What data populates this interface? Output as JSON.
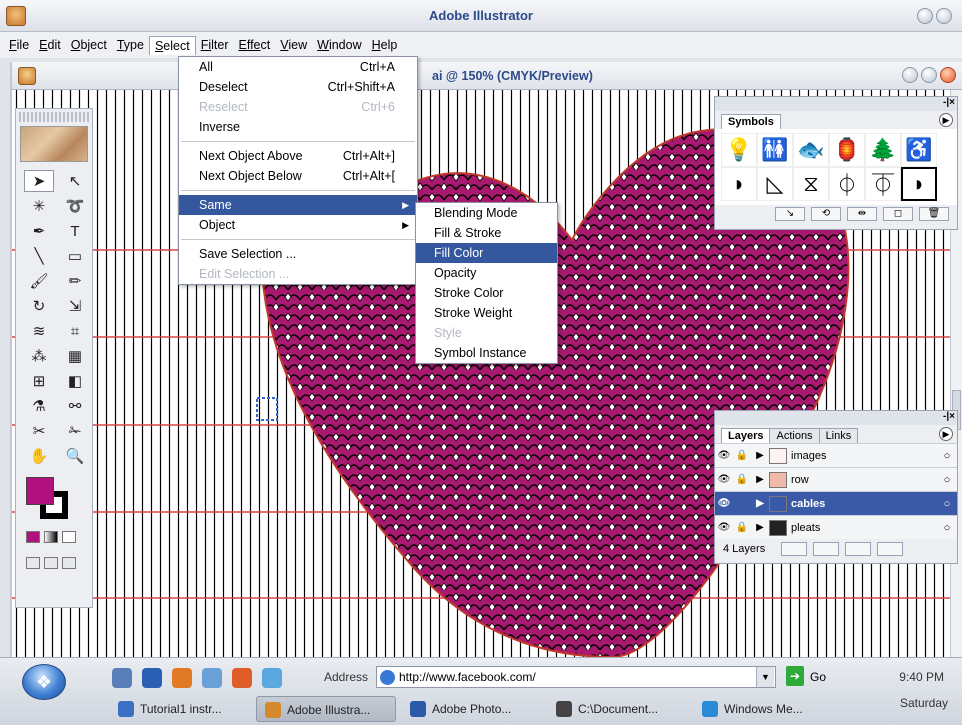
{
  "app": {
    "title": "Adobe Illustrator",
    "document_title": "ai @ 150% (CMYK/Preview)"
  },
  "menubar": [
    {
      "label": "File",
      "accel": "F",
      "rest": "ile"
    },
    {
      "label": "Edit",
      "accel": "E",
      "rest": "dit"
    },
    {
      "label": "Object",
      "accel": "O",
      "rest": "bject"
    },
    {
      "label": "Type",
      "accel": "T",
      "rest": "ype"
    },
    {
      "label": "Select",
      "accel": "S",
      "rest": "elect"
    },
    {
      "label": "Filter",
      "accel": "Fi",
      "rest": "lter"
    },
    {
      "label": "Effect",
      "accel": "Effe",
      "rest": "ct"
    },
    {
      "label": "View",
      "accel": "V",
      "rest": "iew"
    },
    {
      "label": "Window",
      "accel": "W",
      "rest": "indow"
    },
    {
      "label": "Help",
      "accel": "H",
      "rest": "elp"
    }
  ],
  "select_menu": {
    "items": [
      {
        "label": "All",
        "shortcut": "Ctrl+A",
        "disabled": false
      },
      {
        "label": "Deselect",
        "shortcut": "Ctrl+Shift+A",
        "disabled": false
      },
      {
        "label": "Reselect",
        "shortcut": "Ctrl+6",
        "disabled": true
      },
      {
        "label": "Inverse",
        "shortcut": "",
        "disabled": false
      },
      {
        "sep": true
      },
      {
        "label": "Next Object Above",
        "shortcut": "Ctrl+Alt+]",
        "disabled": false
      },
      {
        "label": "Next Object Below",
        "shortcut": "Ctrl+Alt+[",
        "disabled": false
      },
      {
        "sep": true
      },
      {
        "label": "Same",
        "shortcut": "",
        "submenu": true,
        "highlight": true
      },
      {
        "label": "Object",
        "shortcut": "",
        "submenu": true
      },
      {
        "sep": true
      },
      {
        "label": "Save Selection ...",
        "shortcut": "",
        "disabled": false
      },
      {
        "label": "Edit Selection ...",
        "shortcut": "",
        "disabled": true
      }
    ]
  },
  "same_submenu": {
    "items": [
      {
        "label": "Blending Mode",
        "disabled": false
      },
      {
        "label": "Fill & Stroke",
        "disabled": false
      },
      {
        "label": "Fill Color",
        "disabled": false,
        "highlight": true
      },
      {
        "label": "Opacity",
        "disabled": false
      },
      {
        "label": "Stroke Color",
        "disabled": false
      },
      {
        "label": "Stroke Weight",
        "disabled": false
      },
      {
        "label": "Style",
        "disabled": true
      },
      {
        "label": "Symbol Instance",
        "disabled": false
      }
    ]
  },
  "symbols_palette": {
    "tab": "Symbols",
    "symbols": [
      {
        "name": "lightbulb-icon",
        "glyph": "💡"
      },
      {
        "name": "restroom-icon",
        "glyph": "🚻"
      },
      {
        "name": "fish-icon",
        "glyph": "🐟"
      },
      {
        "name": "lantern-icon",
        "glyph": "🏮"
      },
      {
        "name": "tree-icon",
        "glyph": "🌲"
      },
      {
        "name": "wheelchair-icon",
        "glyph": "♿"
      },
      {
        "name": "shape-d-icon",
        "glyph": "◗"
      },
      {
        "name": "shape-triangle-icon",
        "glyph": "◺"
      },
      {
        "name": "shape-hourglass-icon",
        "glyph": "⧖"
      },
      {
        "name": "shape-dome-icon",
        "glyph": "⏀"
      },
      {
        "name": "shape-cup-icon",
        "glyph": "⏁"
      },
      {
        "name": "shape-curve-icon",
        "glyph": "◗"
      }
    ]
  },
  "layers_palette": {
    "tabs": [
      "Layers",
      "Actions",
      "Links"
    ],
    "layers": [
      {
        "name": "images",
        "selected": false,
        "locked": true
      },
      {
        "name": "row",
        "selected": false,
        "locked": true
      },
      {
        "name": "cables",
        "selected": true,
        "locked": false
      },
      {
        "name": "pleats",
        "selected": false,
        "locked": true
      }
    ],
    "count_label": "4 Layers"
  },
  "colors": {
    "fill": "#b0117d",
    "heart_fill": "#a8196f",
    "guide_red": "#d94343",
    "highlight": "#34579e"
  },
  "taskbar": {
    "address_label": "Address",
    "address_value": "http://www.facebook.com/",
    "go_label": "Go",
    "time": "9:40 PM",
    "day": "Saturday",
    "tasks": [
      {
        "label": "Tutorial1 instr...",
        "active": false,
        "color": "#3a6fc2"
      },
      {
        "label": "Adobe Illustra...",
        "active": true,
        "color": "#d48a2c"
      },
      {
        "label": "Adobe Photo...",
        "active": false,
        "color": "#2a5aa8"
      },
      {
        "label": "C:\\Document...",
        "active": false,
        "color": "#444"
      },
      {
        "label": "Windows Me...",
        "active": false,
        "color": "#2b8ad6"
      }
    ]
  }
}
